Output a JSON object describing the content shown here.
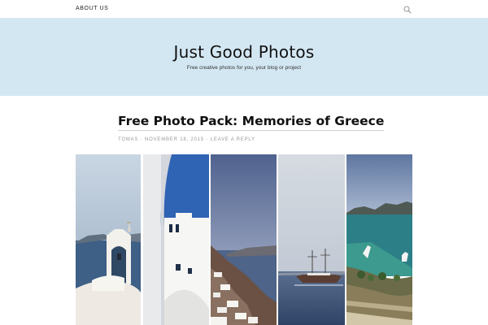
{
  "nav": {
    "about_label": "ABOUT US",
    "search_icon": "search-icon"
  },
  "header": {
    "site_title": "Just Good Photos",
    "tagline": "Free creative photos for you, your blog or project",
    "background": "#d3e7f3"
  },
  "post": {
    "title": "Free Photo Pack: Memories of Greece",
    "author": "TOMAS",
    "separator": "·",
    "date": "NOVEMBER 18, 2015",
    "reply_link": "LEAVE A REPLY"
  },
  "gallery": {
    "photos": [
      {
        "alt": "white chapel bell tower over sea"
      },
      {
        "alt": "white arch against blue sky"
      },
      {
        "alt": "cliffside white village"
      },
      {
        "alt": "sailing ship on blue sea"
      },
      {
        "alt": "bay with boats and coastline"
      }
    ]
  }
}
